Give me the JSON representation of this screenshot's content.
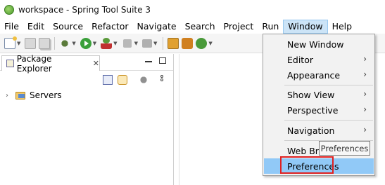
{
  "window": {
    "title": "workspace - Spring Tool Suite 3"
  },
  "menubar": {
    "items": [
      "File",
      "Edit",
      "Source",
      "Refactor",
      "Navigate",
      "Search",
      "Project",
      "Run",
      "Window",
      "Help"
    ],
    "active": "Window"
  },
  "package_explorer": {
    "title": "Package Explorer",
    "close_glyph": "✕",
    "tree": [
      {
        "label": "Servers",
        "expanded": false
      }
    ]
  },
  "window_menu": {
    "items": [
      {
        "label": "New Window",
        "submenu": false
      },
      {
        "label": "Editor",
        "submenu": true
      },
      {
        "label": "Appearance",
        "submenu": true
      },
      {
        "label": "Show View",
        "submenu": true
      },
      {
        "label": "Perspective",
        "submenu": true
      },
      {
        "label": "Navigation",
        "submenu": true
      },
      {
        "label": "Web Bro",
        "submenu": false
      },
      {
        "label": "Preferences",
        "submenu": false,
        "highlighted": true
      }
    ],
    "submenu_arrow": "›"
  },
  "tooltip": {
    "text": "Preferences"
  },
  "colors": {
    "menu_highlight": "#91c9f7",
    "annotation_box": "#e02020",
    "active_menu_bg": "#cce4f7"
  },
  "icons": {
    "app": "spring-leaf-icon",
    "folder": "server-folder-icon"
  }
}
